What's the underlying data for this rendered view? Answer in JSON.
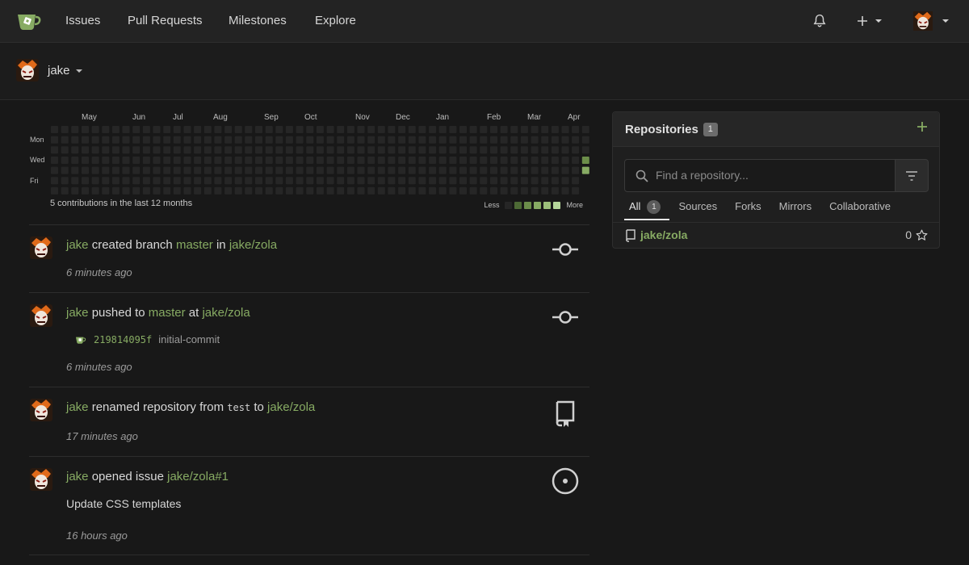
{
  "nav": {
    "items": [
      "Issues",
      "Pull Requests",
      "Milestones",
      "Explore"
    ]
  },
  "user": {
    "name": "jake"
  },
  "heatmap": {
    "months": [
      "May",
      "Jun",
      "Jul",
      "Aug",
      "Sep",
      "Oct",
      "Nov",
      "Dec",
      "Jan",
      "Feb",
      "Mar",
      "Apr"
    ],
    "days": [
      "Mon",
      "Wed",
      "Fri"
    ],
    "summary": "5 contributions in the last 12 months",
    "less": "Less",
    "more": "More",
    "colors": {
      "empty": "#262626",
      "levels": [
        "#2c3a22",
        "#4d6a35",
        "#6c8e4a",
        "#87ab63",
        "#a6c98a"
      ]
    }
  },
  "feed": [
    {
      "actor": "jake",
      "verb": "created branch",
      "ref": "master",
      "prep": "in",
      "repo": "jake/zola",
      "time": "6 minutes ago",
      "icon": "git-commit-icon"
    },
    {
      "actor": "jake",
      "verb": "pushed to",
      "ref": "master",
      "prep": "at",
      "repo": "jake/zola",
      "commit_sha": "219814095f",
      "commit_msg": "initial-commit",
      "time": "6 minutes ago",
      "icon": "git-commit-icon"
    },
    {
      "actor": "jake",
      "verb": "renamed repository from",
      "old_name": "test",
      "prep": "to",
      "repo": "jake/zola",
      "time": "17 minutes ago",
      "icon": "repo-icon"
    },
    {
      "actor": "jake",
      "verb": "opened issue",
      "issue": "jake/zola#1",
      "body": "Update CSS templates",
      "time": "16 hours ago",
      "icon": "issue-opened-icon"
    }
  ],
  "repos": {
    "title": "Repositories",
    "count": "1",
    "search_placeholder": "Find a repository...",
    "tabs": [
      "All",
      "Sources",
      "Forks",
      "Mirrors",
      "Collaborative"
    ],
    "all_count": "1",
    "list": [
      {
        "name": "jake/zola",
        "stars": "0"
      }
    ]
  },
  "colors": {
    "accent": "#87ab63",
    "bg": "#181818"
  }
}
